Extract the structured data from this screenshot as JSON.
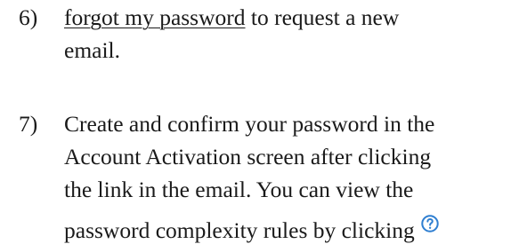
{
  "step6": {
    "number": "6)",
    "link": "forgot my password",
    "line1_rest": " to request a new",
    "line2": "email."
  },
  "step7": {
    "number": "7)",
    "line1": "Create and confirm your password in the",
    "line2": "Account Activation screen after clicking",
    "line3": "the link in the email.  You can view the",
    "line4": "password complexity rules by clicking",
    "icon": "question-circle-icon",
    "icon_color": "#2f7fd1"
  }
}
